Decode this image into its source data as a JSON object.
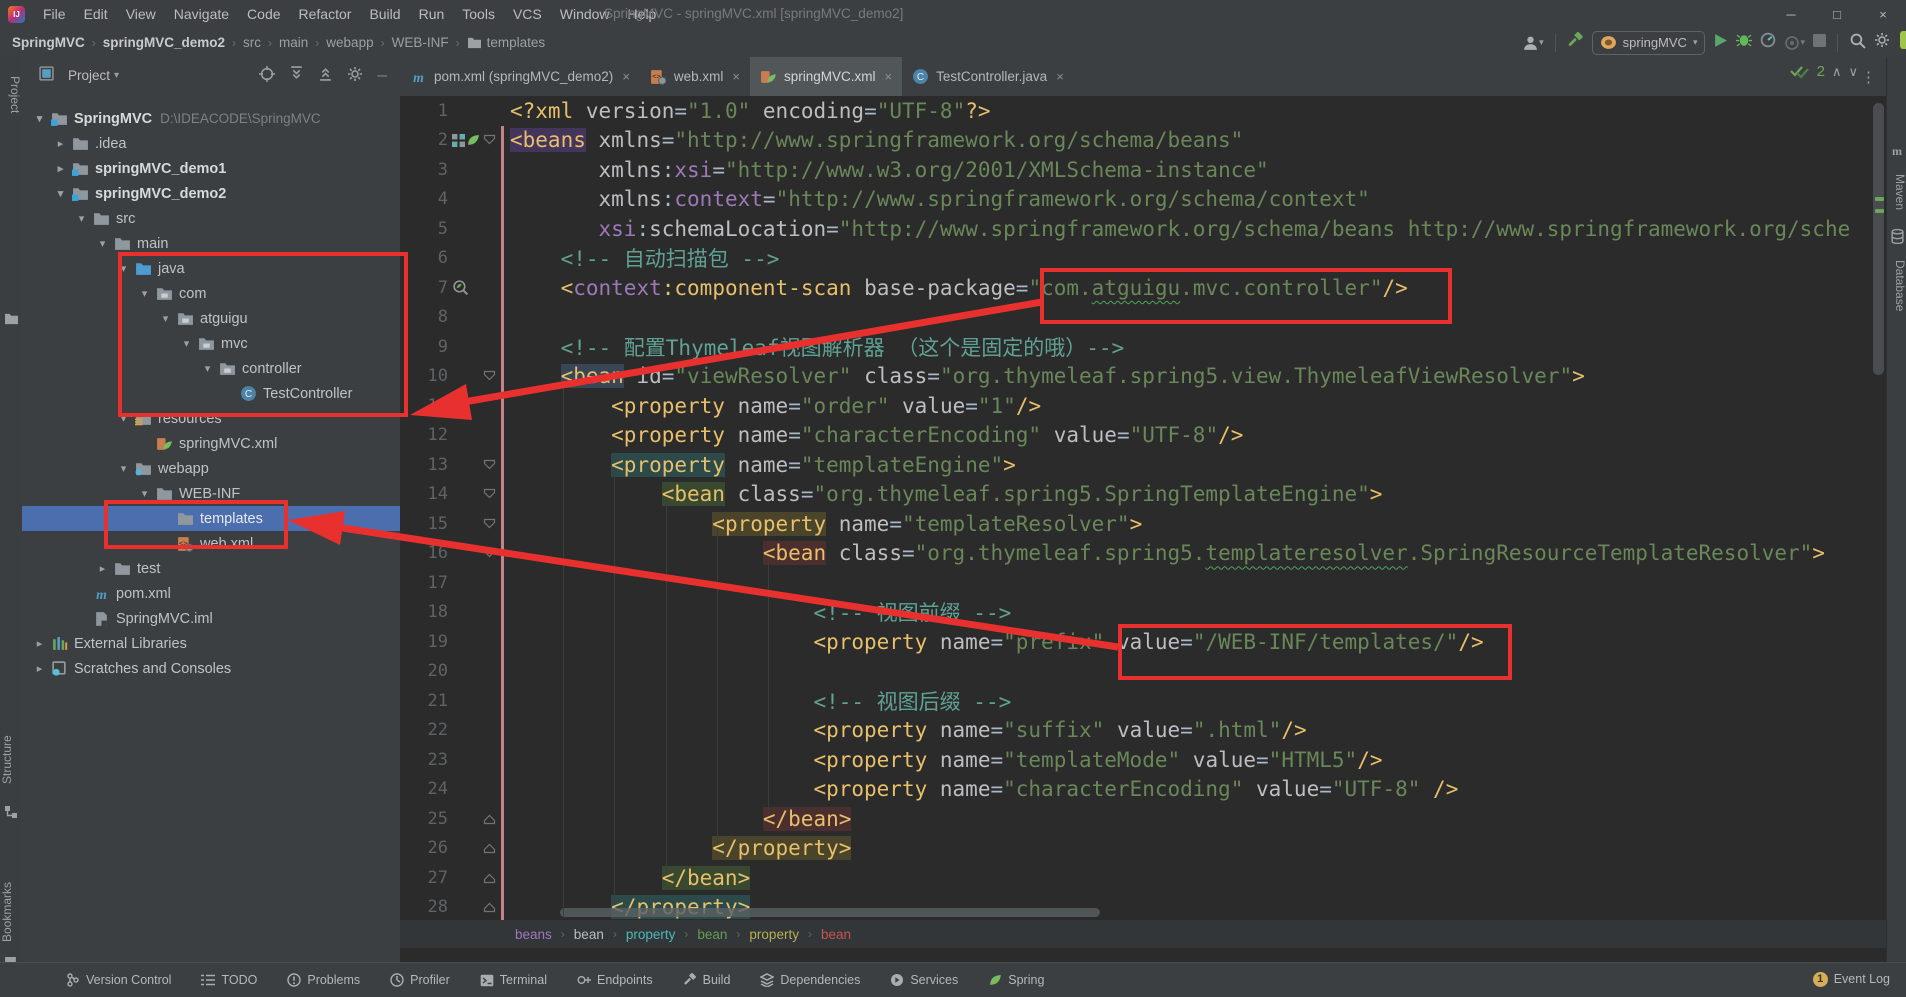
{
  "window": {
    "title": "SpringMVC - springMVC.xml [springMVC_demo2]",
    "controls": [
      {
        "name": "minimize",
        "glyph": "─"
      },
      {
        "name": "maximize",
        "glyph": "□"
      },
      {
        "name": "close",
        "glyph": "×"
      }
    ]
  },
  "menu": [
    "File",
    "Edit",
    "View",
    "Navigate",
    "Code",
    "Refactor",
    "Build",
    "Run",
    "Tools",
    "VCS",
    "Window",
    "Help"
  ],
  "navbar": {
    "path": [
      "SpringMVC",
      "springMVC_demo2",
      "src",
      "main",
      "webapp",
      "WEB-INF",
      "templates"
    ],
    "bold_count": 2,
    "run_config": "springMVC"
  },
  "project_panel": {
    "title": "Project"
  },
  "tool_strips": {
    "left_top": "Project",
    "left_mid": "Structure",
    "left_bottom": "Bookmarks",
    "right": [
      "Maven",
      "Database"
    ]
  },
  "tree": [
    {
      "d": 0,
      "ch": "v",
      "ic": "fmod",
      "label": "SpringMVC",
      "bold": true,
      "extra": "D:\\IDEACODE\\SpringMVC"
    },
    {
      "d": 1,
      "ch": ">",
      "ic": "fold",
      "label": ".idea"
    },
    {
      "d": 1,
      "ch": ">",
      "ic": "fmod",
      "label": "springMVC_demo1",
      "bold": true
    },
    {
      "d": 1,
      "ch": "v",
      "ic": "fmod",
      "label": "springMVC_demo2",
      "bold": true
    },
    {
      "d": 2,
      "ch": "v",
      "ic": "fold",
      "label": "src"
    },
    {
      "d": 3,
      "ch": "v",
      "ic": "fold",
      "label": "main"
    },
    {
      "d": 4,
      "ch": "v",
      "ic": "fsrc",
      "label": "java"
    },
    {
      "d": 5,
      "ch": "v",
      "ic": "pkg",
      "label": "com"
    },
    {
      "d": 6,
      "ch": "v",
      "ic": "pkg",
      "label": "atguigu"
    },
    {
      "d": 7,
      "ch": "v",
      "ic": "pkg",
      "label": "mvc"
    },
    {
      "d": 8,
      "ch": "v",
      "ic": "pkg",
      "label": "controller"
    },
    {
      "d": 9,
      "ch": "",
      "ic": "cls",
      "label": "TestController"
    },
    {
      "d": 4,
      "ch": "v",
      "ic": "fres",
      "label": "resources"
    },
    {
      "d": 5,
      "ch": "",
      "ic": "spr",
      "label": "springMVC.xml"
    },
    {
      "d": 4,
      "ch": "v",
      "ic": "fweb",
      "label": "webapp"
    },
    {
      "d": 5,
      "ch": "v",
      "ic": "fold",
      "label": "WEB-INF"
    },
    {
      "d": 6,
      "ch": "",
      "ic": "fold",
      "label": "templates",
      "selected": true
    },
    {
      "d": 6,
      "ch": "",
      "ic": "xmlweb",
      "label": "web.xml"
    },
    {
      "d": 3,
      "ch": ">",
      "ic": "fold",
      "label": "test"
    },
    {
      "d": 2,
      "ch": "",
      "ic": "mvn",
      "label": "pom.xml"
    },
    {
      "d": 2,
      "ch": "",
      "ic": "iml",
      "label": "SpringMVC.iml"
    },
    {
      "d": 0,
      "ch": ">",
      "ic": "lib",
      "label": "External Libraries"
    },
    {
      "d": 0,
      "ch": ">",
      "ic": "scr",
      "label": "Scratches and Consoles"
    }
  ],
  "tabs": [
    {
      "icon": "mvn",
      "label": "pom.xml (springMVC_demo2)",
      "active": false
    },
    {
      "icon": "xmlweb",
      "label": "web.xml",
      "active": false
    },
    {
      "icon": "spr",
      "label": "springMVC.xml",
      "active": true
    },
    {
      "icon": "cls",
      "label": "TestController.java",
      "active": false
    }
  ],
  "inspection": {
    "count": "2"
  },
  "code": {
    "lines": [
      {
        "n": 1,
        "ind": 0,
        "tk": [
          [
            "tg",
            "<?xml "
          ],
          [
            "at",
            "version"
          ],
          [
            "pl",
            "="
          ],
          [
            "st",
            "\"1.0\""
          ],
          [
            "pl",
            " "
          ],
          [
            "at",
            "encoding"
          ],
          [
            "pl",
            "="
          ],
          [
            "st",
            "\"UTF-8\""
          ],
          [
            "tg",
            "?>"
          ]
        ]
      },
      {
        "n": 2,
        "ind": 0,
        "tk": [
          [
            "tg hl-purple",
            "<beans"
          ],
          [
            "pl",
            " "
          ],
          [
            "at",
            "xmlns"
          ],
          [
            "pl",
            "="
          ],
          [
            "st",
            "\"http://www.springframework.org/schema/beans\""
          ]
        ]
      },
      {
        "n": 3,
        "ind": 7,
        "tk": [
          [
            "at",
            "xmlns"
          ],
          [
            "pl",
            ":"
          ],
          [
            "ns",
            "xsi"
          ],
          [
            "pl",
            "="
          ],
          [
            "st",
            "\"http://www.w3.org/2001/XMLSchema-instance\""
          ]
        ]
      },
      {
        "n": 4,
        "ind": 7,
        "tk": [
          [
            "at",
            "xmlns"
          ],
          [
            "pl",
            ":"
          ],
          [
            "ns",
            "context"
          ],
          [
            "pl",
            "="
          ],
          [
            "st",
            "\"http://www.springframework.org/schema/context\""
          ]
        ]
      },
      {
        "n": 5,
        "ind": 7,
        "tk": [
          [
            "ns",
            "xsi"
          ],
          [
            "pl",
            ":"
          ],
          [
            "at",
            "schemaLocation"
          ],
          [
            "pl",
            "="
          ],
          [
            "st",
            "\"http://www.springframework.org/schema/beans http://www.springframework.org/sche"
          ]
        ]
      },
      {
        "n": 6,
        "ind": 4,
        "tk": [
          [
            "cm",
            "<!-- 自动扫描包 -->"
          ]
        ]
      },
      {
        "n": 7,
        "ind": 4,
        "tk": [
          [
            "tg",
            "<"
          ],
          [
            "ns",
            "context"
          ],
          [
            "tg",
            ":component-scan"
          ],
          [
            "pl",
            " "
          ],
          [
            "at",
            "base-package"
          ],
          [
            "pl",
            "="
          ],
          [
            "st",
            "\"com."
          ],
          [
            "st sq",
            "atguigu"
          ],
          [
            "st",
            ".mvc.controller\""
          ],
          [
            "tg",
            "/>"
          ]
        ]
      },
      {
        "n": 8,
        "ind": 0,
        "tk": []
      },
      {
        "n": 9,
        "ind": 4,
        "tk": [
          [
            "cm",
            "<!-- 配置Thymeleaf视图解析器 （这个是固定的哦）-->"
          ]
        ]
      },
      {
        "n": 10,
        "ind": 4,
        "tk": [
          [
            "tg hl-blue",
            "<bean"
          ],
          [
            "pl",
            " "
          ],
          [
            "at",
            "id"
          ],
          [
            "pl",
            "="
          ],
          [
            "st",
            "\"viewResolver\""
          ],
          [
            "pl",
            " "
          ],
          [
            "at",
            "class"
          ],
          [
            "pl",
            "="
          ],
          [
            "st",
            "\"org.thymeleaf.spring5.view.ThymeleafViewResolver\""
          ],
          [
            "tg",
            ">"
          ]
        ]
      },
      {
        "n": 11,
        "ind": 8,
        "tk": [
          [
            "tg",
            "<property"
          ],
          [
            "pl",
            " "
          ],
          [
            "at",
            "name"
          ],
          [
            "pl",
            "="
          ],
          [
            "st",
            "\"order\""
          ],
          [
            "pl",
            " "
          ],
          [
            "at",
            "value"
          ],
          [
            "pl",
            "="
          ],
          [
            "st",
            "\"1\""
          ],
          [
            "tg",
            "/>"
          ]
        ]
      },
      {
        "n": 12,
        "ind": 8,
        "tk": [
          [
            "tg",
            "<property"
          ],
          [
            "pl",
            " "
          ],
          [
            "at",
            "name"
          ],
          [
            "pl",
            "="
          ],
          [
            "st",
            "\"characterEncoding\""
          ],
          [
            "pl",
            " "
          ],
          [
            "at",
            "value"
          ],
          [
            "pl",
            "="
          ],
          [
            "st",
            "\"UTF-8\""
          ],
          [
            "tg",
            "/>"
          ]
        ]
      },
      {
        "n": 13,
        "ind": 8,
        "tk": [
          [
            "tg hl-teal",
            "<property"
          ],
          [
            "pl",
            " "
          ],
          [
            "at",
            "name"
          ],
          [
            "pl",
            "="
          ],
          [
            "st",
            "\"templateEngine\""
          ],
          [
            "tg",
            ">"
          ]
        ]
      },
      {
        "n": 14,
        "ind": 12,
        "tk": [
          [
            "tg hl-green",
            "<bean"
          ],
          [
            "pl",
            " "
          ],
          [
            "at",
            "class"
          ],
          [
            "pl",
            "="
          ],
          [
            "st",
            "\"org.thymeleaf.spring5.SpringTemplateEngine\""
          ],
          [
            "tg",
            ">"
          ]
        ]
      },
      {
        "n": 15,
        "ind": 16,
        "tk": [
          [
            "tg hl-olive",
            "<property"
          ],
          [
            "pl",
            " "
          ],
          [
            "at",
            "name"
          ],
          [
            "pl",
            "="
          ],
          [
            "st",
            "\"templateResolver\""
          ],
          [
            "tg",
            ">"
          ]
        ]
      },
      {
        "n": 16,
        "ind": 20,
        "tk": [
          [
            "tg hl-red",
            "<bean"
          ],
          [
            "pl",
            " "
          ],
          [
            "at",
            "class"
          ],
          [
            "pl",
            "="
          ],
          [
            "st",
            "\"org.thymeleaf.spring5."
          ],
          [
            "st sq",
            "templateresolver"
          ],
          [
            "st",
            ".SpringResourceTemplateResolver\""
          ],
          [
            "tg",
            ">"
          ]
        ]
      },
      {
        "n": 17,
        "ind": 0,
        "tk": []
      },
      {
        "n": 18,
        "ind": 24,
        "tk": [
          [
            "cm",
            "<!-- 视图前缀 -->"
          ]
        ]
      },
      {
        "n": 19,
        "ind": 24,
        "tk": [
          [
            "tg",
            "<property"
          ],
          [
            "pl",
            " "
          ],
          [
            "at",
            "name"
          ],
          [
            "pl",
            "="
          ],
          [
            "st",
            "\"prefix\""
          ],
          [
            "pl",
            " "
          ],
          [
            "at",
            "value"
          ],
          [
            "pl",
            "="
          ],
          [
            "st",
            "\"/WEB-INF/templates/\""
          ],
          [
            "tg",
            "/>"
          ]
        ]
      },
      {
        "n": 20,
        "ind": 0,
        "tk": []
      },
      {
        "n": 21,
        "ind": 24,
        "tk": [
          [
            "cm",
            "<!-- 视图后缀 -->"
          ]
        ]
      },
      {
        "n": 22,
        "ind": 24,
        "tk": [
          [
            "tg",
            "<property"
          ],
          [
            "pl",
            " "
          ],
          [
            "at",
            "name"
          ],
          [
            "pl",
            "="
          ],
          [
            "st",
            "\"suffix\""
          ],
          [
            "pl",
            " "
          ],
          [
            "at",
            "value"
          ],
          [
            "pl",
            "="
          ],
          [
            "st",
            "\".html\""
          ],
          [
            "tg",
            "/>"
          ]
        ]
      },
      {
        "n": 23,
        "ind": 24,
        "tk": [
          [
            "tg",
            "<property"
          ],
          [
            "pl",
            " "
          ],
          [
            "at",
            "name"
          ],
          [
            "pl",
            "="
          ],
          [
            "st",
            "\"templateMode\""
          ],
          [
            "pl",
            " "
          ],
          [
            "at",
            "value"
          ],
          [
            "pl",
            "="
          ],
          [
            "st",
            "\"HTML5\""
          ],
          [
            "tg",
            "/>"
          ]
        ]
      },
      {
        "n": 24,
        "ind": 24,
        "tk": [
          [
            "tg",
            "<property"
          ],
          [
            "pl",
            " "
          ],
          [
            "at",
            "name"
          ],
          [
            "pl",
            "="
          ],
          [
            "st",
            "\"characterEncoding\""
          ],
          [
            "pl",
            " "
          ],
          [
            "at",
            "value"
          ],
          [
            "pl",
            "="
          ],
          [
            "st",
            "\"UTF-8\""
          ],
          [
            "pl",
            " "
          ],
          [
            "tg",
            "/>"
          ]
        ]
      },
      {
        "n": 25,
        "ind": 20,
        "tk": [
          [
            "tg hl-red",
            "</bean>"
          ]
        ]
      },
      {
        "n": 26,
        "ind": 16,
        "tk": [
          [
            "tg hl-olive",
            "</property>"
          ]
        ]
      },
      {
        "n": 27,
        "ind": 12,
        "tk": [
          [
            "tg hl-green",
            "</bean>"
          ]
        ]
      },
      {
        "n": 28,
        "ind": 8,
        "tk": [
          [
            "tg hl-teal",
            "</property>"
          ]
        ]
      }
    ],
    "gutter": {
      "2": {
        "fold": "open",
        "icons": [
          "beanconfig",
          "leaf"
        ]
      },
      "7": {
        "icons": [
          "scan"
        ]
      },
      "10": {
        "fold": "open"
      },
      "13": {
        "fold": "open"
      },
      "14": {
        "fold": "open"
      },
      "15": {
        "fold": "open"
      },
      "16": {
        "fold": "open"
      },
      "25": {
        "fold": "close"
      },
      "26": {
        "fold": "close"
      },
      "27": {
        "fold": "close"
      },
      "28": {
        "fold": "close"
      }
    }
  },
  "xml_breadcrumb": [
    {
      "label": "beans",
      "color": "bc-purple"
    },
    {
      "label": "bean",
      "color": "bc-white"
    },
    {
      "label": "property",
      "color": "bc-teal"
    },
    {
      "label": "bean",
      "color": "bc-green"
    },
    {
      "label": "property",
      "color": "bc-yellow"
    },
    {
      "label": "bean",
      "color": "bc-red"
    }
  ],
  "status_bar": {
    "items": [
      {
        "icon": "vcs",
        "label": "Version Control"
      },
      {
        "icon": "todo",
        "label": "TODO"
      },
      {
        "icon": "problems",
        "label": "Problems"
      },
      {
        "icon": "profiler",
        "label": "Profiler"
      },
      {
        "icon": "terminal",
        "label": "Terminal"
      },
      {
        "icon": "endpoints",
        "label": "Endpoints"
      },
      {
        "icon": "buildtool",
        "label": "Build"
      },
      {
        "icon": "deps",
        "label": "Dependencies"
      },
      {
        "icon": "services",
        "label": "Services"
      },
      {
        "icon": "springleaf",
        "label": "Spring"
      }
    ],
    "event_log": {
      "badge": "1",
      "label": "Event Log"
    }
  },
  "colors": {
    "annotation_red": "#e8312f",
    "selection_blue": "#4b6eaf",
    "editor_bg": "#2b2b2b",
    "panel_bg": "#3c3f41",
    "tag_yellow": "#e8bf6a",
    "string_green": "#6a8759"
  }
}
